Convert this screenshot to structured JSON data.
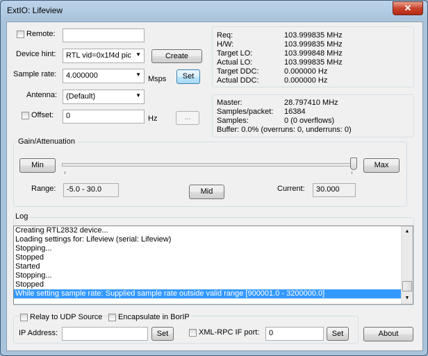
{
  "window": {
    "title": "ExtIO: Lifeview",
    "close_glyph": "✕"
  },
  "remote": {
    "label": "Remote:",
    "value": "",
    "checked": false
  },
  "device_hint": {
    "label": "Device hint:",
    "value": "RTL vid=0x1f4d pic",
    "create_label": "Create"
  },
  "sample_rate": {
    "label": "Sample rate:",
    "value": "4.000000",
    "unit": "Msps",
    "set_label": "Set"
  },
  "antenna": {
    "label": "Antenna:",
    "value": "(Default)"
  },
  "offset": {
    "label": "Offset:",
    "value": "0",
    "unit": "Hz",
    "more_label": "...",
    "checked": false
  },
  "freq_info": {
    "rows": [
      {
        "label": "Req:",
        "value": "103.999835 MHz"
      },
      {
        "label": "H/W:",
        "value": "103.999835 MHz"
      },
      {
        "label": "Target LO:",
        "value": "103.999848 MHz"
      },
      {
        "label": "Actual LO:",
        "value": "103.999835 MHz"
      },
      {
        "label": "Target DDC:",
        "value": "0.000000 Hz"
      },
      {
        "label": "Actual DDC:",
        "value": "0.000000 Hz"
      }
    ]
  },
  "stream_info": {
    "rows": [
      {
        "label": "Master:",
        "value": "28.797410 MHz"
      },
      {
        "label": "Samples/packet:",
        "value": "16384"
      },
      {
        "label": "Samples:",
        "value": "0 (0 overflows)"
      }
    ],
    "buffer": "Buffer: 0.0% (overruns: 0, underruns: 0)"
  },
  "gain": {
    "title": "Gain/Attenuation",
    "min_label": "Min",
    "max_label": "Max",
    "mid_label": "Mid",
    "range_label": "Range:",
    "range_value": "-5.0 - 30.0",
    "current_label": "Current:",
    "current_value": "30.000",
    "slider_fraction": 1.0
  },
  "log": {
    "title": "Log",
    "lines": [
      "Creating RTL2832 device...",
      "Loading settings for: Lifeview (serial: Lifeview)",
      "Stopping...",
      "Stopped",
      "Started",
      "Stopping...",
      "Stopped",
      "While setting sample rate: Supplied sample rate outside valid range [900001.0 - 3200000.0]"
    ],
    "selected_index": 7
  },
  "network": {
    "relay_label": "Relay to UDP Source",
    "encapsulate_label": "Encapsulate in BorIP",
    "ip_label": "IP Address:",
    "ip_value": "",
    "ip_set_label": "Set",
    "xmlrpc_label": "XML-RPC IF port:",
    "xmlrpc_value": "0",
    "xmlrpc_set_label": "Set"
  },
  "about_label": "About"
}
